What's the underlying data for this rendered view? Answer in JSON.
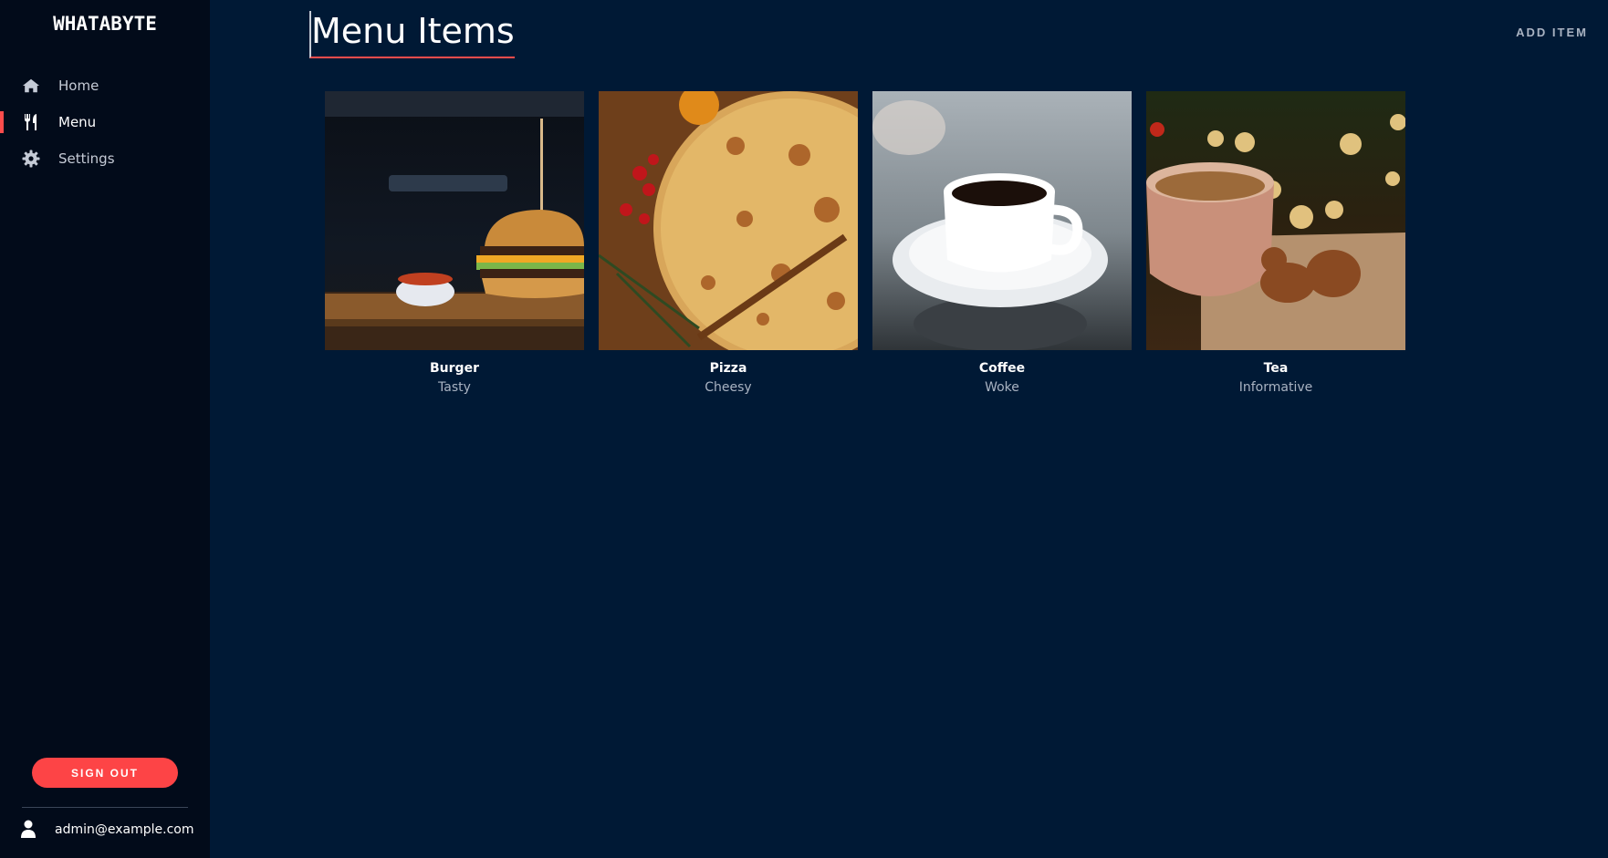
{
  "sidebar": {
    "brand": "WHATABYTE",
    "items": [
      {
        "label": "Home",
        "icon": "home-icon"
      },
      {
        "label": "Menu",
        "icon": "utensils-icon",
        "active": true
      },
      {
        "label": "Settings",
        "icon": "gear-icon"
      }
    ],
    "signout_label": "SIGN OUT",
    "user_email": "admin@example.com"
  },
  "header": {
    "title": "Menu Items",
    "add_item_label": "ADD ITEM"
  },
  "menu_items": [
    {
      "name": "Burger",
      "description": "Tasty",
      "image": "burger-photo"
    },
    {
      "name": "Pizza",
      "description": "Cheesy",
      "image": "pizza-photo"
    },
    {
      "name": "Coffee",
      "description": "Woke",
      "image": "coffee-photo"
    },
    {
      "name": "Tea",
      "description": "Informative",
      "image": "tea-photo"
    }
  ],
  "colors": {
    "background": "#001935",
    "sidebar": "#020b1a",
    "accent": "#fd4c4c"
  }
}
